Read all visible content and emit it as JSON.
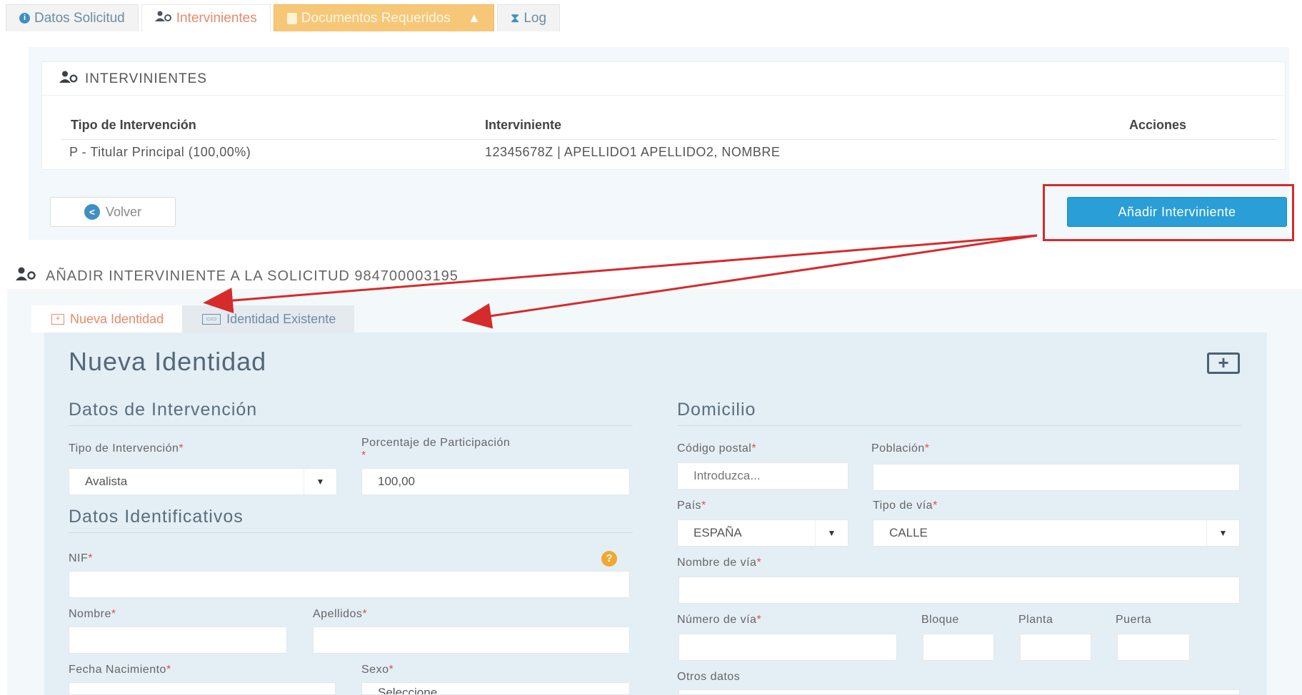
{
  "top_tabs": [
    {
      "label": "Datos Solicitud",
      "icon": "info-icon"
    },
    {
      "label": "Intervinientes",
      "icon": "users-icon"
    },
    {
      "label": "Documentos Requeridos",
      "icon": "document-icon",
      "badge_icon": "warning-icon"
    },
    {
      "label": "Log",
      "icon": "hourglass-icon"
    }
  ],
  "intervinientes": {
    "title": "INTERVINIENTES",
    "columns": [
      "Tipo de Intervención",
      "Interviniente",
      "Acciones"
    ],
    "rows": [
      {
        "tipo": "P - Titular Principal (100,00%)",
        "interviniente": "12345678Z | APELLIDO1 APELLIDO2, NOMBRE",
        "acciones": ""
      }
    ],
    "back_label": "Volver",
    "add_label": "Añadir Interviniente"
  },
  "add_section": {
    "title": "AÑADIR INTERVINIENTE A LA SOLICITUD 984700003195",
    "tabs": [
      "Nueva Identidad",
      "Identidad Existente"
    ],
    "form_title": "Nueva Identidad",
    "intervencion": {
      "heading": "Datos de Intervención",
      "tipo_label": "Tipo de Intervención",
      "tipo_value": "Avalista",
      "porcentaje_label": "Porcentaje de Participación",
      "porcentaje_value": "100,00"
    },
    "identificativos": {
      "heading": "Datos Identificativos",
      "nif_label": "NIF",
      "nombre_label": "Nombre",
      "apellidos_label": "Apellidos",
      "fecha_label": "Fecha Nacimiento",
      "sexo_label": "Sexo",
      "sexo_value": "Seleccione"
    },
    "domicilio": {
      "heading": "Domicilio",
      "cp_label": "Código postal",
      "cp_placeholder": "Introduzca...",
      "poblacion_label": "Población",
      "pais_label": "País",
      "pais_value": "ESPAÑA",
      "tipo_via_label": "Tipo de vía",
      "tipo_via_value": "CALLE",
      "nombre_via_label": "Nombre de vía",
      "numero_via_label": "Número de vía",
      "bloque_label": "Bloque",
      "planta_label": "Planta",
      "puerta_label": "Puerta",
      "otros_label": "Otros datos"
    },
    "required_mark": "*"
  },
  "colors": {
    "accent_blue": "#2a9ed6",
    "active_tab": "#e98a6a",
    "warning_tab": "#f7c778",
    "annotation_red": "#d52b2b"
  }
}
